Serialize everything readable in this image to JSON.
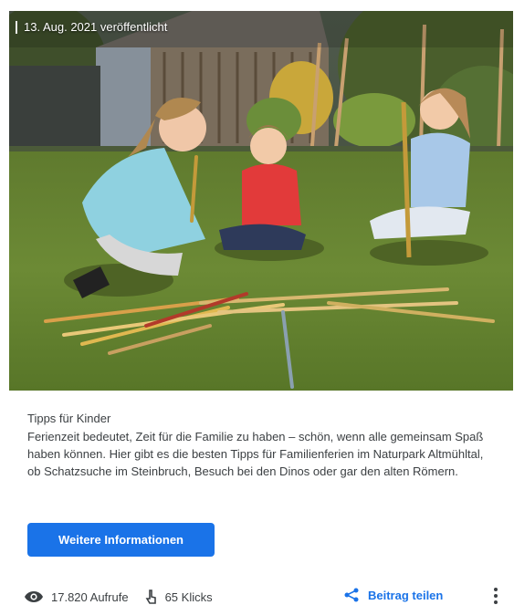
{
  "post": {
    "date_label": "13. Aug. 2021 veröffentlicht",
    "category": "Tipps für Kinder",
    "description": "Ferienzeit bedeutet, Zeit für die Familie zu haben – schön, wenn alle gemeinsam Spaß haben können. Hier gibt es die besten Tipps für Familienferien im Naturpark Altmühltal, ob Schatzsuche im Steinbruch, Besuch bei den Dinos oder gar den alten Römern.",
    "button_label": "Weitere Informationen"
  },
  "stats": {
    "views_label": "17.820 Aufrufe",
    "clicks_label": "65 Klicks",
    "views_icon": "eye-icon",
    "clicks_icon": "touch-icon"
  },
  "actions": {
    "share_label": "Beitrag teilen",
    "share_icon": "share-icon",
    "more_icon": "more-vert-icon"
  },
  "colors": {
    "accent": "#1a73e8",
    "text": "#3c4043"
  }
}
